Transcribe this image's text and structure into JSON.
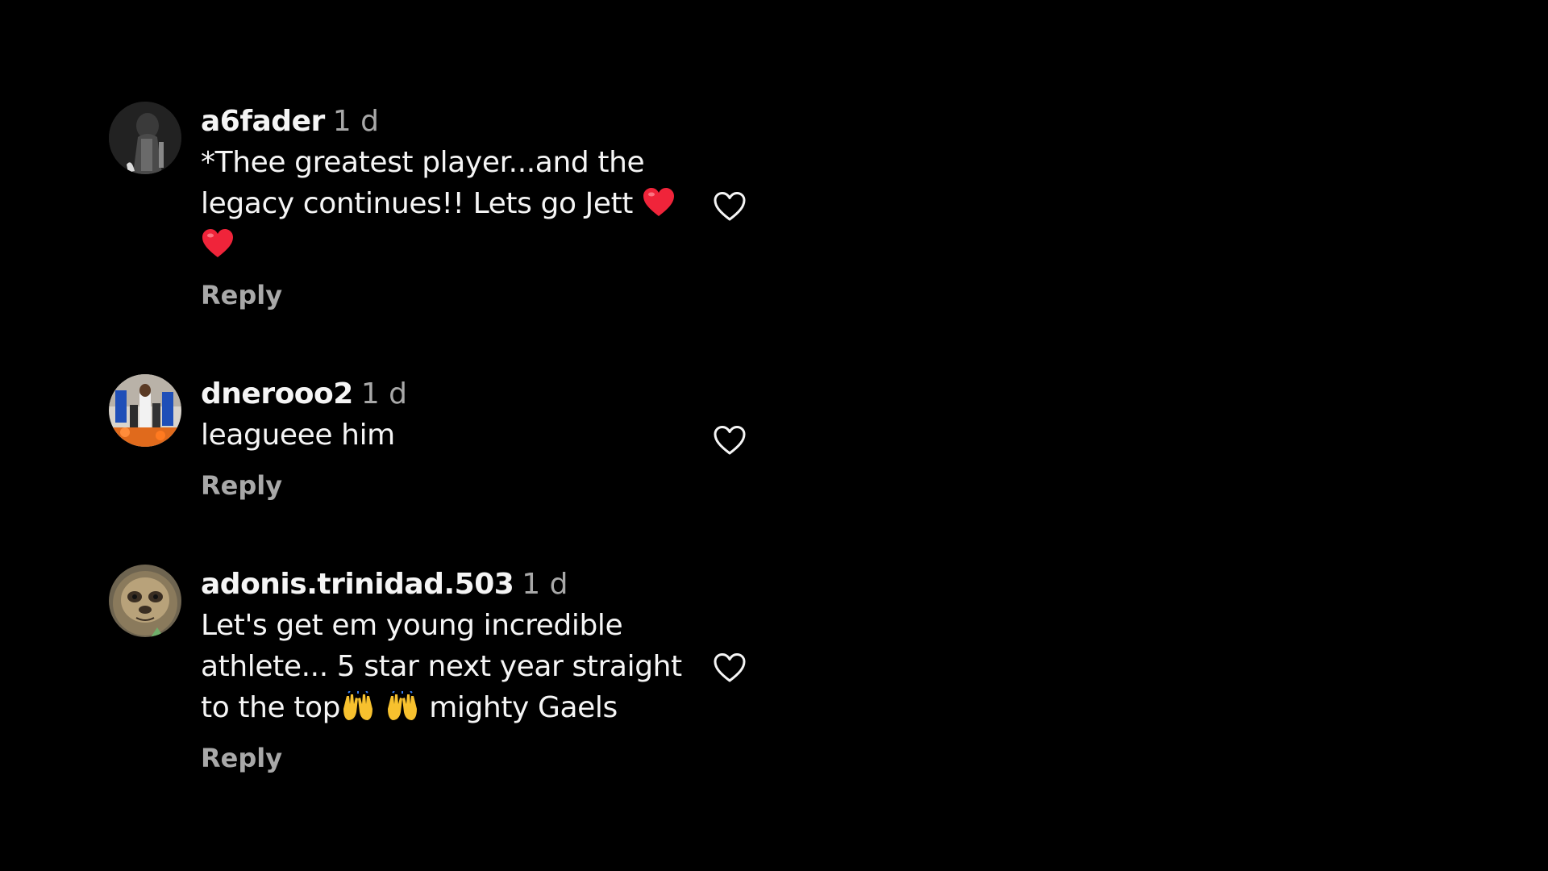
{
  "comments": [
    {
      "username": "a6fader",
      "time": "1 d",
      "text_part1": "*Thee greatest player...and the legacy continues!! Lets go Jett ",
      "emoji": [
        "red-heart-emoji",
        "red-heart-emoji"
      ],
      "reply_label": "Reply",
      "like_icon": "heart-outline-icon"
    },
    {
      "username": "dnerooo2",
      "time": "1 d",
      "text": "leagueee him",
      "reply_label": "Reply",
      "like_icon": "heart-outline-icon"
    },
    {
      "username": "adonis.trinidad.503",
      "time": "1 d",
      "text_part1": "Let's get em young incredible athlete... 5 star next year straight to the top",
      "text_part2": " mighty Gaels",
      "emoji": [
        "raising-hands-emoji",
        "raising-hands-emoji"
      ],
      "reply_label": "Reply",
      "like_icon": "heart-outline-icon"
    }
  ],
  "colors": {
    "background": "#000000",
    "primary_text": "#f5f5f5",
    "secondary_text": "#a8a8a8",
    "emoji_heart": "#f0243a"
  }
}
